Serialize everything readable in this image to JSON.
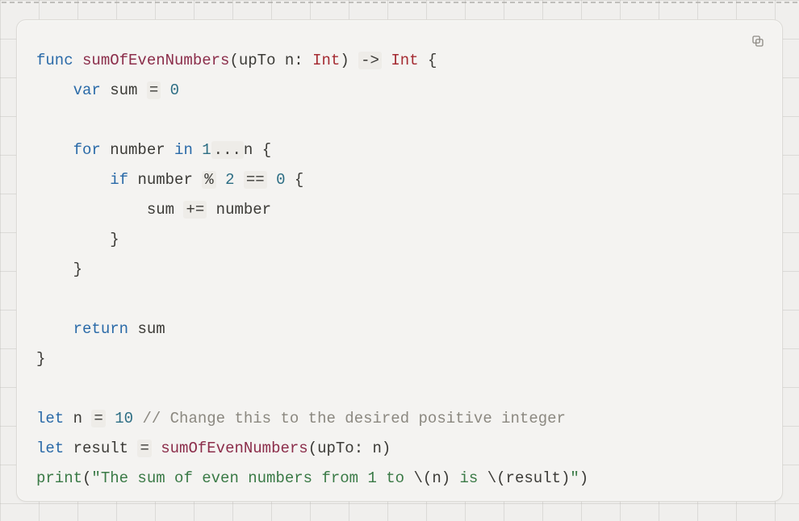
{
  "language": "swift",
  "code": {
    "tokens": [
      [
        [
          "func ",
          "keyword"
        ],
        [
          "sumOfEvenNumbers",
          "funcname"
        ],
        [
          "(",
          "punct"
        ],
        [
          "upTo",
          "param"
        ],
        [
          " ",
          "punct"
        ],
        [
          "n",
          "param"
        ],
        [
          ":",
          "punct"
        ],
        [
          " ",
          "punct"
        ],
        [
          "Int",
          "type"
        ],
        [
          ")",
          "punct"
        ],
        [
          " ",
          "punct"
        ],
        [
          "->",
          "op-box"
        ],
        [
          " ",
          "punct"
        ],
        [
          "Int",
          "type"
        ],
        [
          " ",
          "punct"
        ],
        [
          "{",
          "punct"
        ]
      ],
      [
        [
          "    ",
          "punct"
        ],
        [
          "var ",
          "keyword"
        ],
        [
          "sum",
          "ident"
        ],
        [
          " ",
          "punct"
        ],
        [
          "=",
          "op-box"
        ],
        [
          " ",
          "punct"
        ],
        [
          "0",
          "number"
        ]
      ],
      [],
      [
        [
          "    ",
          "punct"
        ],
        [
          "for ",
          "keyword"
        ],
        [
          "number",
          "ident"
        ],
        [
          " ",
          "punct"
        ],
        [
          "in ",
          "keyword"
        ],
        [
          "1",
          "number"
        ],
        [
          "...",
          "op-box"
        ],
        [
          "n",
          "ident"
        ],
        [
          " ",
          "punct"
        ],
        [
          "{",
          "punct"
        ]
      ],
      [
        [
          "        ",
          "punct"
        ],
        [
          "if ",
          "keyword"
        ],
        [
          "number",
          "ident"
        ],
        [
          " ",
          "punct"
        ],
        [
          "%",
          "op-box"
        ],
        [
          " ",
          "punct"
        ],
        [
          "2",
          "number"
        ],
        [
          " ",
          "punct"
        ],
        [
          "==",
          "op-box"
        ],
        [
          " ",
          "punct"
        ],
        [
          "0",
          "number"
        ],
        [
          " ",
          "punct"
        ],
        [
          "{",
          "punct"
        ]
      ],
      [
        [
          "            ",
          "punct"
        ],
        [
          "sum",
          "ident"
        ],
        [
          " ",
          "punct"
        ],
        [
          "+=",
          "op-box"
        ],
        [
          " ",
          "punct"
        ],
        [
          "number",
          "ident"
        ]
      ],
      [
        [
          "        ",
          "punct"
        ],
        [
          "}",
          "punct"
        ]
      ],
      [
        [
          "    ",
          "punct"
        ],
        [
          "}",
          "punct"
        ]
      ],
      [],
      [
        [
          "    ",
          "punct"
        ],
        [
          "return ",
          "keyword"
        ],
        [
          "sum",
          "ident"
        ]
      ],
      [
        [
          "}",
          "punct"
        ]
      ],
      [],
      [
        [
          "let ",
          "keyword"
        ],
        [
          "n",
          "ident"
        ],
        [
          " ",
          "punct"
        ],
        [
          "=",
          "op-box"
        ],
        [
          " ",
          "punct"
        ],
        [
          "10",
          "number"
        ],
        [
          " ",
          "punct"
        ],
        [
          "// Change this to the desired positive integer",
          "comment"
        ]
      ],
      [
        [
          "let ",
          "keyword"
        ],
        [
          "result",
          "ident"
        ],
        [
          " ",
          "punct"
        ],
        [
          "=",
          "op-box"
        ],
        [
          " ",
          "punct"
        ],
        [
          "sumOfEvenNumbers",
          "callname"
        ],
        [
          "(",
          "punct"
        ],
        [
          "upTo",
          "argname"
        ],
        [
          ":",
          "punct"
        ],
        [
          " ",
          "punct"
        ],
        [
          "n",
          "ident"
        ],
        [
          ")",
          "punct"
        ]
      ],
      [
        [
          "print",
          "builtin"
        ],
        [
          "(",
          "punct"
        ],
        [
          "\"The sum of even numbers from 1 to ",
          "string"
        ],
        [
          "\\(",
          "punct"
        ],
        [
          "n",
          "ident"
        ],
        [
          ")",
          "punct"
        ],
        [
          " is ",
          "string"
        ],
        [
          "\\(",
          "punct"
        ],
        [
          "result",
          "ident"
        ],
        [
          ")",
          "punct"
        ],
        [
          "\"",
          "string"
        ],
        [
          ")",
          "punct"
        ]
      ]
    ]
  },
  "copy_button": {
    "title": "Copy",
    "icon": "copy-icon"
  }
}
